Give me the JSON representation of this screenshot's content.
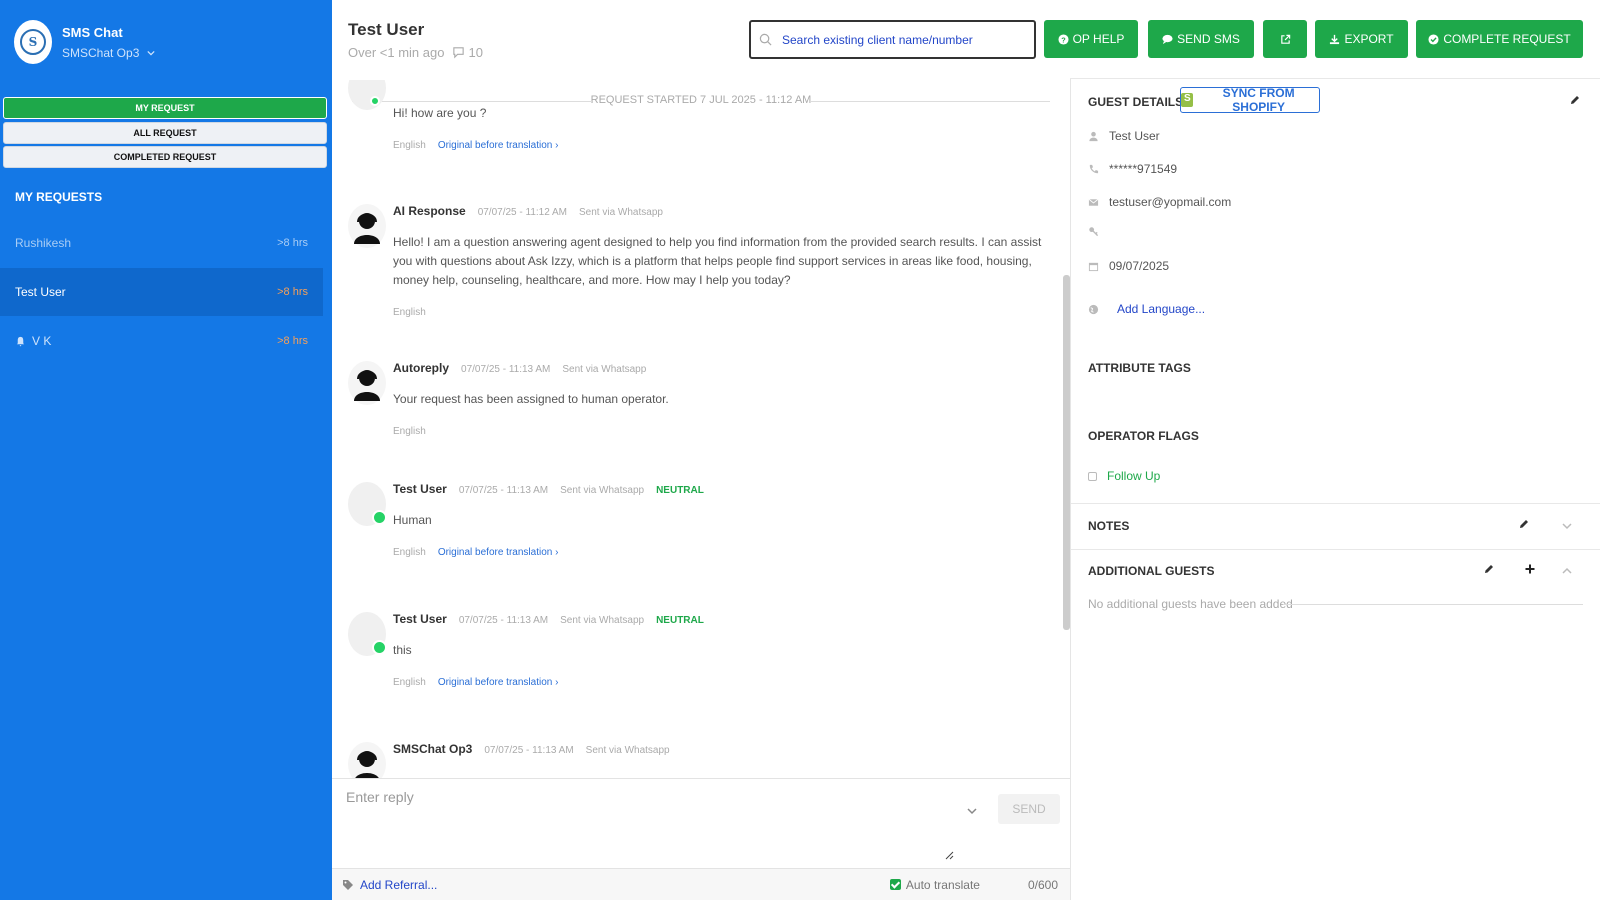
{
  "sidebar": {
    "app_name": "SMS Chat",
    "operator": "SMSChat Op3",
    "logo_glyph": "S",
    "filters": [
      {
        "label": "MY REQUEST",
        "active": true
      },
      {
        "label": "ALL REQUEST",
        "active": false
      },
      {
        "label": "COMPLETED REQUEST",
        "active": false
      }
    ],
    "section_title": "MY REQUESTS",
    "requests": [
      {
        "name": "Rushikesh",
        "time": ">8 hrs"
      },
      {
        "name": "Test User",
        "time": ">8 hrs"
      },
      {
        "name": "V K",
        "time": ">8 hrs"
      }
    ]
  },
  "header": {
    "title": "Test User",
    "subtitle": "Over <1 min ago",
    "comment_count": "10",
    "search_placeholder": "Search existing client name/number",
    "buttons": {
      "op_help": "OP HELP",
      "send_sms": "SEND SMS",
      "export": "EXPORT",
      "complete": "COMPLETE REQUEST"
    }
  },
  "chat": {
    "started": "REQUEST STARTED 7 JUL 2025 - 11:12 AM",
    "messages": [
      {
        "text": "Hi! how are you ?",
        "lang": "English",
        "orig": "Original before translation ›"
      },
      {
        "sender": "AI Response",
        "time": "07/07/25 - 11:12 AM",
        "via": "Sent via Whatsapp",
        "text": "Hello! I am a question answering agent designed to help you find information from the provided search results. I can assist you with questions about Ask Izzy, which is a platform that helps people find support services in areas like food, housing, money help, counseling, healthcare, and more. How may I help you today?",
        "lang": "English"
      },
      {
        "sender": "Autoreply",
        "time": "07/07/25 - 11:13 AM",
        "via": "Sent via Whatsapp",
        "text": "Your request has been assigned to human operator.",
        "lang": "English"
      },
      {
        "sender": "Test User",
        "time": "07/07/25 - 11:13 AM",
        "via": "Sent via Whatsapp",
        "sentiment": "NEUTRAL",
        "text": "Human",
        "lang": "English",
        "orig": "Original before translation ›"
      },
      {
        "sender": "Test User",
        "time": "07/07/25 - 11:13 AM",
        "via": "Sent via Whatsapp",
        "sentiment": "NEUTRAL",
        "text": "this",
        "lang": "English",
        "orig": "Original before translation ›"
      },
      {
        "sender": "SMSChat Op3",
        "time": "07/07/25 - 11:13 AM",
        "via": "Sent via Whatsapp"
      }
    ]
  },
  "reply": {
    "placeholder": "Enter reply",
    "send_label": "SEND",
    "add_referral": "Add Referral...",
    "auto_translate": "Auto translate",
    "char_count": "0/600"
  },
  "guest": {
    "title": "GUEST DETAILS",
    "sync_label": "SYNC FROM SHOPIFY",
    "name": "Test User",
    "phone": "******971549",
    "email": "testuser@yopmail.com",
    "date": "09/07/2025",
    "add_language": "Add Language...",
    "attribute_tags": "ATTRIBUTE TAGS",
    "operator_flags": "OPERATOR FLAGS",
    "follow_up": "Follow Up",
    "notes": "NOTES",
    "additional_guests": "ADDITIONAL GUESTS",
    "no_guests": "No additional guests have been added"
  },
  "colors": {
    "sidebar_bg": "#1478e6",
    "accent_green": "#1ea84a",
    "link_blue": "#2346c8"
  }
}
